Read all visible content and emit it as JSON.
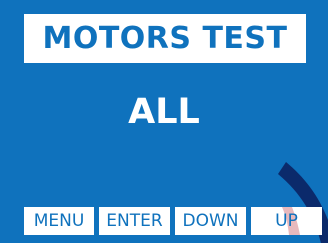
{
  "screen": {
    "title": "MOTORS TEST",
    "mode_value": "ALL"
  },
  "softkeys": {
    "menu": "MENU",
    "enter": "ENTER",
    "down": "DOWN",
    "up": "UP"
  },
  "colors": {
    "background": "#0f72bd",
    "panel": "#ffffff",
    "title_text": "#0f72bd",
    "watermark": "#0b2a6b"
  },
  "decorations": {
    "corner_mark": "watermark-swoosh-icon"
  }
}
